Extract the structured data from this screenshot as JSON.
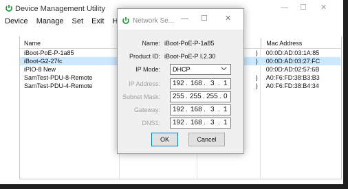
{
  "main_window": {
    "title": "Device Management Utility",
    "menu": [
      "Device",
      "Manage",
      "Set",
      "Exit",
      "Help"
    ],
    "caption": {
      "minimize": "—",
      "maximize": "☐",
      "close": "✕"
    },
    "table": {
      "headers": {
        "name": "Name",
        "mac": "Mac Address"
      },
      "rows": [
        {
          "name": "iBoot-PoE-P-1a85",
          "mid": ")",
          "mac": "00:0D:AD:03:1A:85",
          "selected": false
        },
        {
          "name": "iBoot-G2-27fc",
          "mid": ")",
          "mac": "00:0D:AD:03:27:FC",
          "selected": true
        },
        {
          "name": "iPIO-8 New",
          "mid": "",
          "mac": "00:0D:AD:02:57:6B",
          "selected": false
        },
        {
          "name": "SamTest-PDU-8-Remote",
          "mid": ")",
          "mac": "A0:F6:FD:38:B3:B3",
          "selected": false
        },
        {
          "name": "SamTest-PDU-4-Remote",
          "mid": ")",
          "mac": "A0:F6:FD:38:B4:34",
          "selected": false
        }
      ]
    }
  },
  "dialog": {
    "title": "Network Se...",
    "caption": {
      "minimize": "—",
      "maximize": "☐",
      "close": "✕"
    },
    "name_label": "Name:",
    "name_value": "iBoot-PoE-P-1a85",
    "product_label": "Product ID:",
    "product_value": "iBoot-PoE-P I.2.30",
    "ip_mode_label": "IP Mode:",
    "ip_mode_value": "DHCP",
    "ip_address_label": "IP Address:",
    "ip_address": [
      "192",
      "168",
      "3",
      "1"
    ],
    "subnet_label": "Subnet Mask:",
    "subnet": [
      "255",
      "255",
      "255",
      "0"
    ],
    "gateway_label": "Gateway:",
    "gateway": [
      "192",
      "168",
      "3",
      "1"
    ],
    "dns_label": "DNS1:",
    "dns": [
      "192",
      "168",
      "3",
      "1"
    ],
    "ok_label": "OK",
    "cancel_label": "Cancel"
  },
  "colors": {
    "selection": "#cce8ff",
    "power_icon": "#2e9b3e",
    "default_button_border": "#0078d7"
  }
}
